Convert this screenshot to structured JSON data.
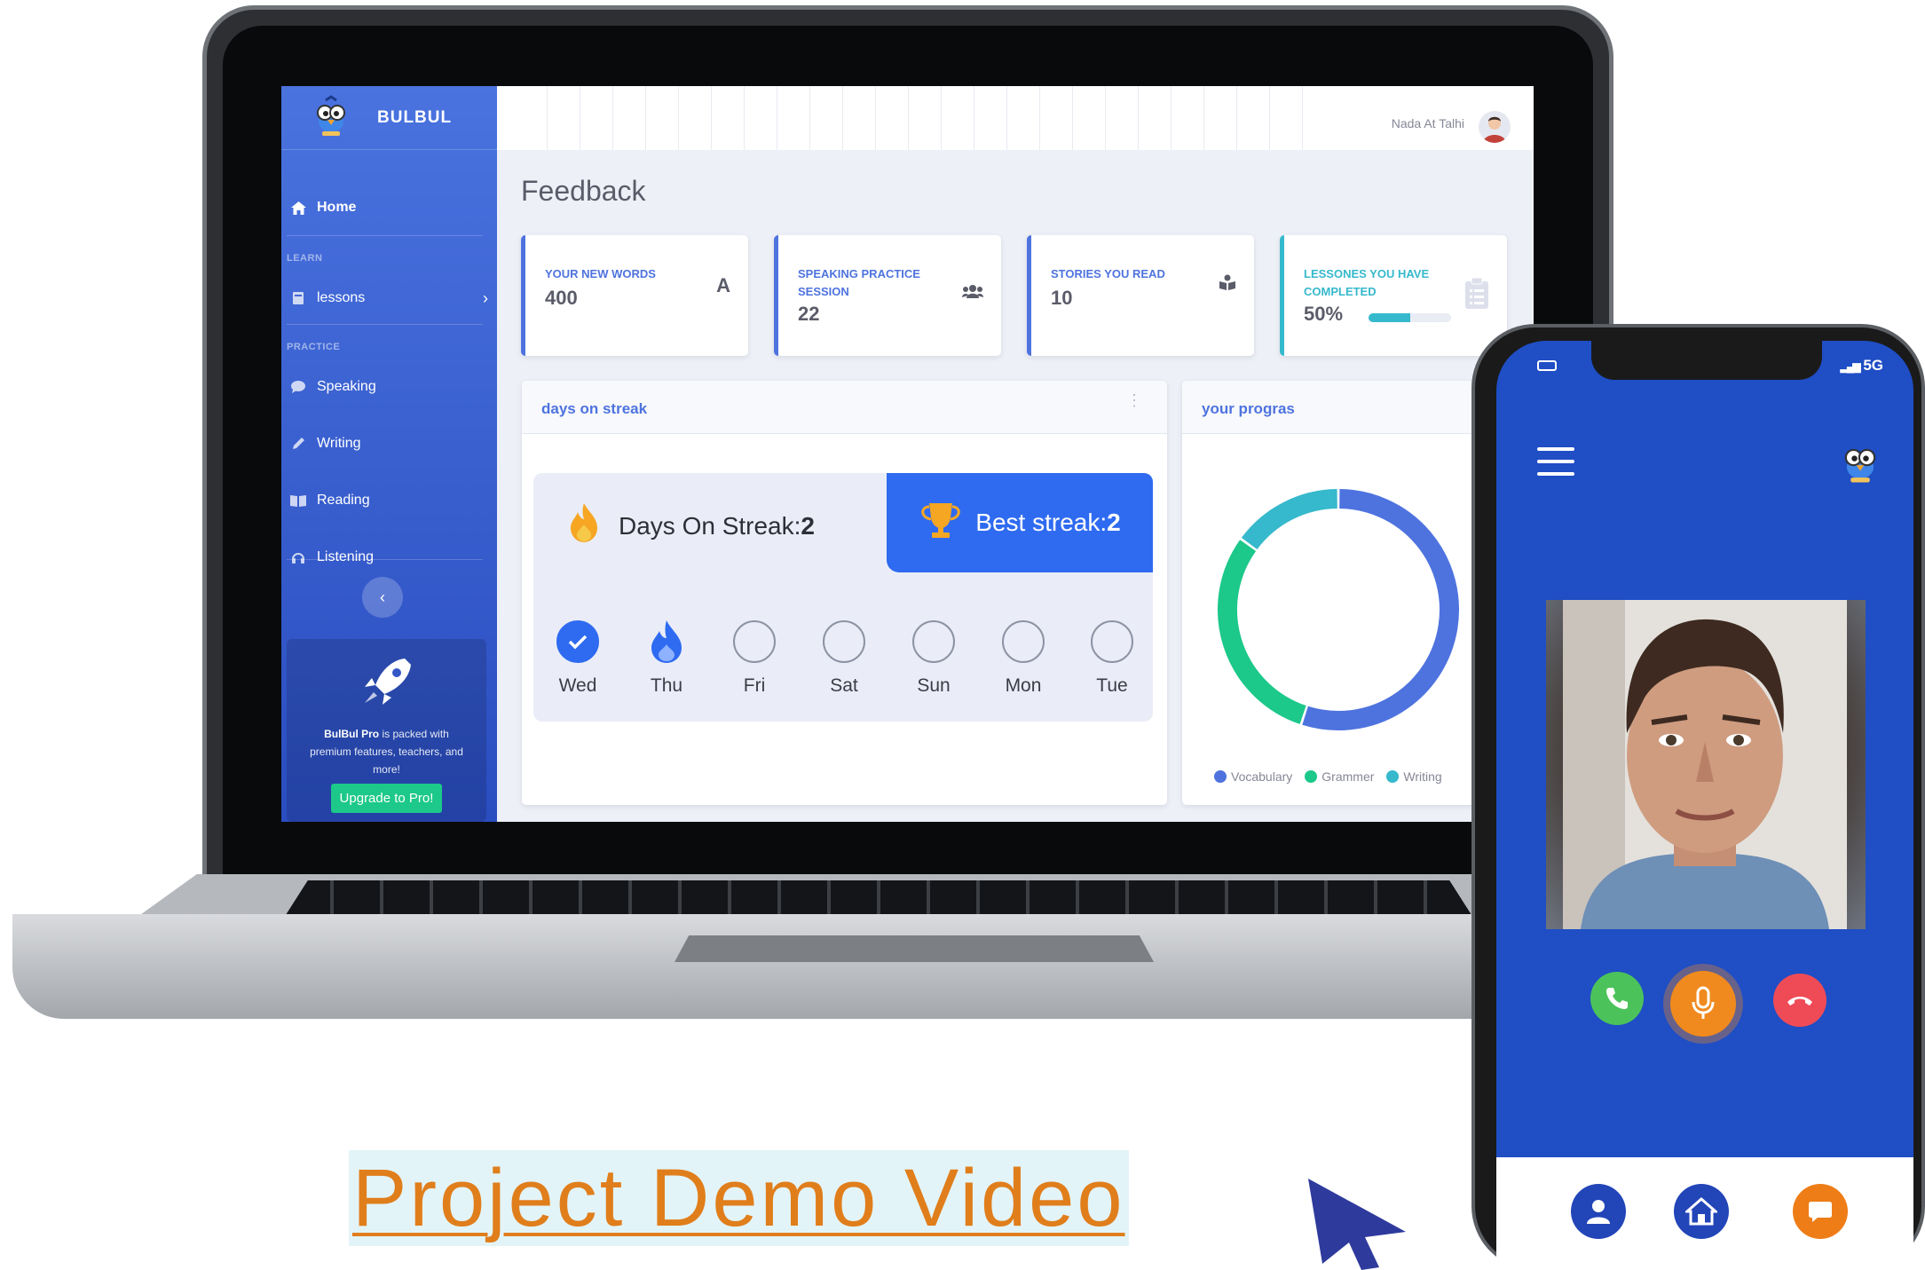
{
  "app": {
    "brand": "BULBUL"
  },
  "sidebar": {
    "home": "Home",
    "learn_heading": "LEARN",
    "lessons": "lessons",
    "practice_heading": "PRACTICE",
    "items": [
      "Speaking",
      "Writing",
      "Reading",
      "Listening"
    ],
    "promo_bold": "BulBul Pro",
    "promo_text": " is packed with premium features, teachers, and more!",
    "upgrade": "Upgrade to Pro!"
  },
  "topbar": {
    "user": "Nada At Talhi"
  },
  "page": {
    "title": "Feedback"
  },
  "cards": [
    {
      "label": "YOUR NEW WORDS",
      "value": "400",
      "icon": "letter-a-icon",
      "color": "#4e73df"
    },
    {
      "label": "SPEAKING PRACTICE SESSION",
      "value": "22",
      "icon": "users-icon",
      "color": "#4e73df"
    },
    {
      "label": "STORIES YOU READ",
      "value": "10",
      "icon": "book-reader-icon",
      "color": "#4e73df"
    },
    {
      "label": "LESSONES YOU HAVE COMPLETED",
      "value": "50%",
      "progress": 0.5,
      "icon": "clipboard-list-icon",
      "color": "#36b9cc"
    }
  ],
  "streak": {
    "panel_title": "days on streak",
    "days_label": "Days On Streak: ",
    "days_value": "2",
    "best_label": "Best streak: ",
    "best_value": "2",
    "days": [
      {
        "name": "Wed",
        "state": "done"
      },
      {
        "name": "Thu",
        "state": "flame"
      },
      {
        "name": "Fri",
        "state": "empty"
      },
      {
        "name": "Sat",
        "state": "empty"
      },
      {
        "name": "Sun",
        "state": "empty"
      },
      {
        "name": "Mon",
        "state": "empty"
      },
      {
        "name": "Tue",
        "state": "empty"
      }
    ]
  },
  "progress": {
    "panel_title": "your progras",
    "chart_data": {
      "type": "pie",
      "series": [
        {
          "name": "Vocabulary",
          "value": 55,
          "color": "#4e73df"
        },
        {
          "name": "Grammer",
          "value": 30,
          "color": "#1cc88a"
        },
        {
          "name": "Writing",
          "value": 15,
          "color": "#36b9cc"
        }
      ]
    }
  },
  "phone": {
    "network": "5G"
  },
  "demo": {
    "link": "Project Demo Video"
  },
  "colors": {
    "primary": "#4e73df",
    "success": "#1cc88a",
    "info": "#36b9cc",
    "orange": "#e07e1c",
    "phone_bg": "#1f4ec5"
  }
}
